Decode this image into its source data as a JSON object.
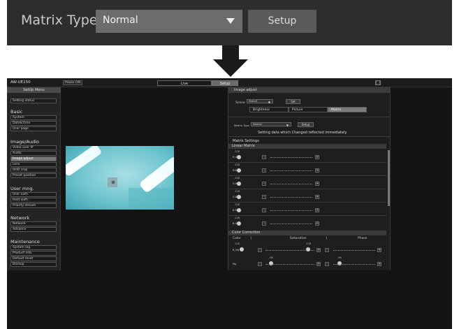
{
  "zoom": {
    "matrix_type_label": "Matrix Type",
    "matrix_type_value": "Normal",
    "setup_button": "Setup"
  },
  "header": {
    "brand": "AW-UE150",
    "power": "Power ON",
    "tab_live": "Live",
    "tab_setup": "Setup",
    "fullscreen": "[ ]"
  },
  "menu": {
    "title": "SetUp Menu",
    "setting_status": "Setting status",
    "basic_title": "Basic",
    "basic_items": [
      "System",
      "Date&Time",
      "User page"
    ],
    "image_title": "Image/Audio",
    "image_items": [
      "Video over IP",
      "Audio",
      "Image adjust",
      "Lens",
      "UHD crop",
      "Preset position"
    ],
    "user_title": "User mng.",
    "user_items": [
      "User auth.",
      "Host auth.",
      "Priority stream"
    ],
    "network_title": "Network",
    "network_items": [
      "Network",
      "Advance"
    ],
    "maint_title": "Maintenance",
    "maint_items": [
      "System log",
      "Product info.",
      "Default reset",
      "Backup"
    ]
  },
  "panel": {
    "title": "Image adjust",
    "scene_label": "Scene",
    "scene_value": "Scene1",
    "set_button": "Set",
    "subtabs": [
      "Brightness",
      "Picture",
      "Matrix"
    ],
    "matrix_type_label": "Matrix Type",
    "matrix_type_value": "Normal",
    "setup_button": "Setup",
    "notice": "Setting data which Changed reflected immediately",
    "matrix_settings": "Matrix Settings",
    "linear_matrix": "Linear Matrix",
    "linear_rows": [
      {
        "value": "-128",
        "label": "R-G"
      },
      {
        "value": "-128",
        "label": "R-B"
      },
      {
        "value": "-128",
        "label": "G-R"
      },
      {
        "value": "-128",
        "label": "G-B"
      },
      {
        "value": "-128",
        "label": "B-R"
      },
      {
        "value": "-128",
        "label": "B-G"
      }
    ],
    "color_correction": "Color Correction",
    "cc_headers": [
      "Color",
      "|",
      "Saturation",
      "|",
      "Phase"
    ],
    "cc_rows": [
      {
        "label": "B_Mg",
        "left_value": "-128",
        "mid_value": "-128"
      },
      {
        "label": "Mg",
        "left_value": "-98",
        "mid_value": "-98"
      }
    ]
  }
}
